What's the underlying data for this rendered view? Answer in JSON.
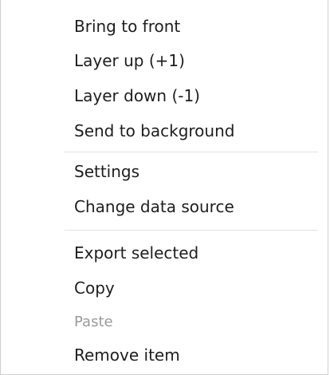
{
  "context_menu": {
    "groups": [
      {
        "items": [
          {
            "label": "Bring to front",
            "enabled": true
          },
          {
            "label": "Layer up (+1)",
            "enabled": true
          },
          {
            "label": "Layer down (-1)",
            "enabled": true
          },
          {
            "label": "Send to background",
            "enabled": true
          }
        ]
      },
      {
        "items": [
          {
            "label": "Settings",
            "enabled": true
          },
          {
            "label": "Change data source",
            "enabled": true
          }
        ]
      },
      {
        "items": [
          {
            "label": "Export selected",
            "enabled": true
          },
          {
            "label": "Copy",
            "enabled": true
          },
          {
            "label": "Paste",
            "enabled": false
          },
          {
            "label": "Remove item",
            "enabled": true
          }
        ]
      }
    ]
  }
}
